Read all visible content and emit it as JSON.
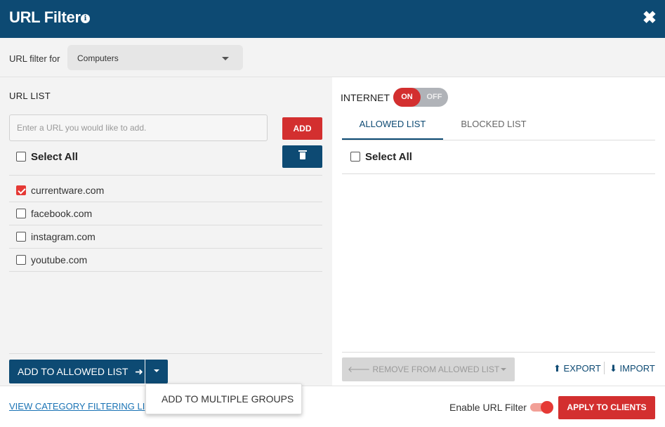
{
  "header": {
    "title": "URL Filter",
    "info_icon": "i",
    "close_icon": "✖"
  },
  "filter": {
    "label": "URL filter for",
    "selected": "Computers"
  },
  "url_list": {
    "title": "URL LIST",
    "input_placeholder": "Enter a URL you would like to add.",
    "add_label": "ADD",
    "select_all": "Select All",
    "items": [
      {
        "url": "currentware.com",
        "checked": true
      },
      {
        "url": "facebook.com",
        "checked": false
      },
      {
        "url": "instagram.com",
        "checked": false
      },
      {
        "url": "youtube.com",
        "checked": false
      }
    ],
    "add_to_allowed": "ADD TO ALLOWED LIST",
    "arrow": "➜"
  },
  "internet": {
    "label": "INTERNET",
    "on": "ON",
    "off": "OFF",
    "state": "ON"
  },
  "tabs": [
    {
      "label": "ALLOWED LIST",
      "active": true
    },
    {
      "label": "BLOCKED LIST",
      "active": false
    }
  ],
  "allowed": {
    "select_all": "Select All",
    "remove_label": "REMOVE FROM ALLOWED LIST",
    "left_arrow": "🡐",
    "export_label": "EXPORT",
    "import_label": "IMPORT"
  },
  "footer": {
    "category_link": "VIEW CATEGORY FILTERING LI",
    "enable_label": "Enable URL Filter",
    "apply_label": "APPLY TO CLIENTS"
  },
  "menu": {
    "item": "ADD TO MULTIPLE GROUPS"
  },
  "colors": {
    "primary": "#0d4a73",
    "accent": "#d32f2f"
  }
}
